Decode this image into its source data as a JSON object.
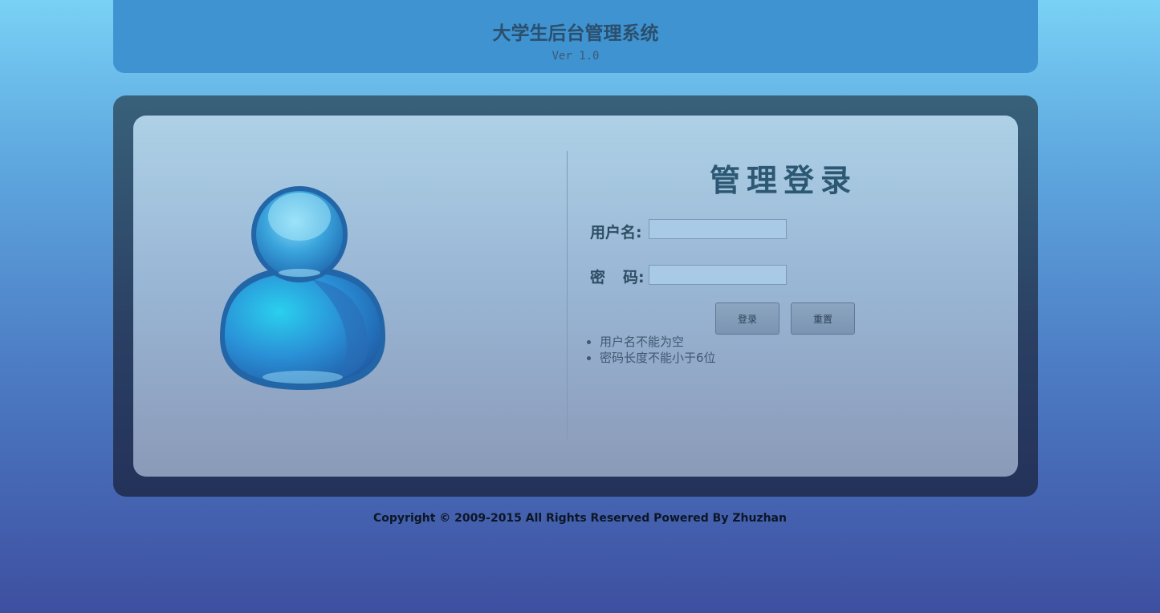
{
  "header": {
    "title": "大学生后台管理系统",
    "version": "Ver 1.0"
  },
  "login": {
    "title": "管理登录",
    "username_label": "用户名:",
    "password_label_a": "密",
    "password_label_b": "码:",
    "username_value": "",
    "password_value": "",
    "login_button": "登录",
    "reset_button": "重置",
    "errors": [
      "用户名不能为空",
      "密码长度不能小于6位"
    ]
  },
  "icons": {
    "avatar": "user-avatar-icon"
  },
  "colors": {
    "header_bg": "#3f93d1",
    "panel_bg": "#2a3f63",
    "title_text": "#2d5873"
  },
  "footer": {
    "copyright": "Copyright © 2009-2015 All Rights Reserved Powered By Zhuzhan"
  }
}
